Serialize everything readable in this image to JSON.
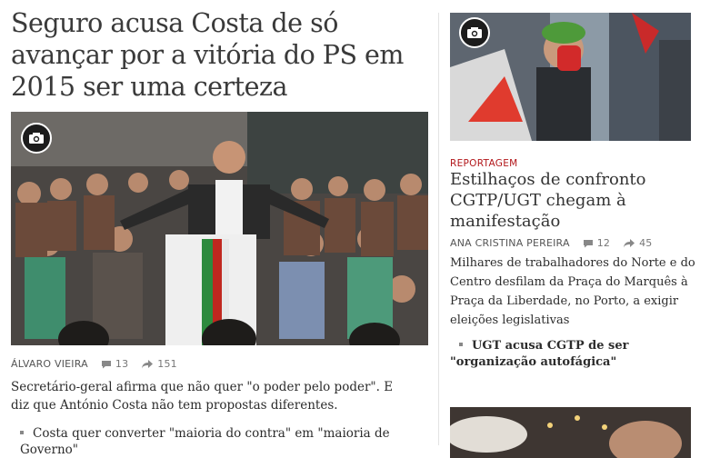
{
  "main_story": {
    "headline": "Seguro acusa Costa de só avançar por a vitória do PS em 2015 ser uma certeza",
    "author": "ÁLVARO VIEIRA",
    "comments": "13",
    "shares": "151",
    "summary": "Secretário-geral afirma que não quer \"o poder pelo poder\". E diz que António Costa não tem propostas diferentes.",
    "related": "Costa quer converter \"maioria do contra\" em \"maioria de Governo\""
  },
  "side_story": {
    "kicker": "REPORTAGEM",
    "headline": "Estilhaços de confronto CGTP/UGT chegam à manifestação",
    "author": "ANA CRISTINA PEREIRA",
    "comments": "12",
    "shares": "45",
    "summary": "Milhares de trabalhadores do Norte e do Centro desfilam da Praça do Marquês à Praça da Liberdade, no Porto, a exigir eleições legislativas",
    "related": "UGT acusa CGTP de ser \"organização autofágica\""
  },
  "colors": {
    "kicker": "#b2171b",
    "text": "#2c2c2c",
    "muted": "#777777"
  },
  "icons": {
    "camera": "camera-icon",
    "comment": "comment-bubble-icon",
    "share": "share-arrow-icon"
  }
}
